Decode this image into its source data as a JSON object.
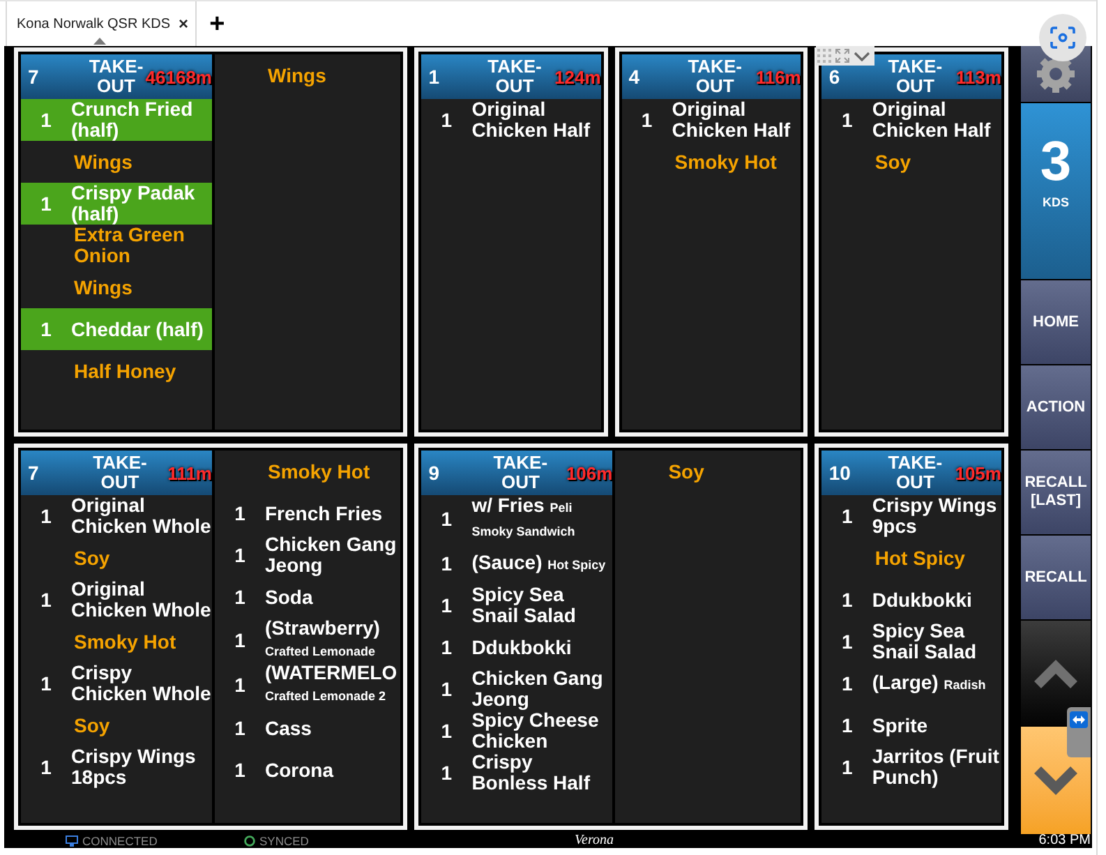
{
  "browser": {
    "tabs": [
      {
        "title": "Kona Norwalk QSR KDS",
        "close": "×"
      }
    ],
    "new_tab": "+"
  },
  "tickets": [
    {
      "number": "7",
      "order_type": "TAKE-OUT",
      "elapsed": "46168m",
      "columns": [
        {
          "lines": [
            {
              "kind": "item",
              "qty": "1",
              "name": "Crunch Fried (half)",
              "highlighted": true
            },
            {
              "kind": "modifier",
              "text": "Wings"
            },
            {
              "kind": "item",
              "qty": "1",
              "name": "Crispy Padak (half)",
              "highlighted": true
            },
            {
              "kind": "modifier",
              "text": "Extra Green Onion"
            },
            {
              "kind": "modifier",
              "text": "Wings"
            },
            {
              "kind": "item",
              "qty": "1",
              "name": "Cheddar (half)",
              "highlighted": true
            },
            {
              "kind": "modifier",
              "text": "Half Honey"
            }
          ]
        },
        {
          "lines": [
            {
              "kind": "modifier",
              "text": "Wings"
            }
          ]
        }
      ]
    },
    {
      "number": "1",
      "order_type": "TAKE-OUT",
      "elapsed": "124m",
      "columns": [
        {
          "lines": [
            {
              "kind": "item",
              "qty": "1",
              "name": "Original Chicken Half",
              "highlighted": false
            }
          ]
        }
      ]
    },
    {
      "number": "4",
      "order_type": "TAKE-OUT",
      "elapsed": "116m",
      "columns": [
        {
          "lines": [
            {
              "kind": "item",
              "qty": "1",
              "name": "Original Chicken Half",
              "highlighted": false
            },
            {
              "kind": "modifier",
              "text": "Smoky Hot"
            }
          ]
        }
      ]
    },
    {
      "number": "6",
      "order_type": "TAKE-OUT",
      "elapsed": "113m",
      "columns": [
        {
          "lines": [
            {
              "kind": "item",
              "qty": "1",
              "name": "Original Chicken Half",
              "highlighted": false
            },
            {
              "kind": "modifier",
              "text": "Soy"
            }
          ]
        }
      ]
    },
    {
      "number": "7",
      "order_type": "TAKE-OUT",
      "elapsed": "111m",
      "columns": [
        {
          "lines": [
            {
              "kind": "item",
              "qty": "1",
              "name": "Original Chicken Whole",
              "highlighted": false
            },
            {
              "kind": "modifier",
              "text": "Soy"
            },
            {
              "kind": "item",
              "qty": "1",
              "name": "Original Chicken Whole",
              "highlighted": false
            },
            {
              "kind": "modifier",
              "text": "Smoky Hot"
            },
            {
              "kind": "item",
              "qty": "1",
              "name": "Crispy Chicken Whole",
              "highlighted": false
            },
            {
              "kind": "modifier",
              "text": "Soy"
            },
            {
              "kind": "item",
              "qty": "1",
              "name": "Crispy Wings 18pcs",
              "highlighted": false
            }
          ]
        },
        {
          "lines": [
            {
              "kind": "modifier",
              "text": "Smoky Hot"
            },
            {
              "kind": "item",
              "qty": "1",
              "name": "French Fries",
              "highlighted": false
            },
            {
              "kind": "item",
              "qty": "1",
              "name": "Chicken Gang Jeong",
              "highlighted": false
            },
            {
              "kind": "item",
              "qty": "1",
              "name": "Soda",
              "highlighted": false
            },
            {
              "kind": "item",
              "qty": "1",
              "name": "(Strawberry)",
              "note": "Crafted Lemonade",
              "highlighted": false
            },
            {
              "kind": "item",
              "qty": "1",
              "name": "(WATERMELO",
              "note": "Crafted Lemonade 2",
              "highlighted": false
            },
            {
              "kind": "item",
              "qty": "1",
              "name": "Cass",
              "highlighted": false
            },
            {
              "kind": "item",
              "qty": "1",
              "name": "Corona",
              "highlighted": false
            }
          ]
        }
      ]
    },
    {
      "number": "9",
      "order_type": "TAKE-OUT",
      "elapsed": "106m",
      "columns": [
        {
          "lines": [
            {
              "kind": "item",
              "qty": "1",
              "name": "w/ Fries",
              "note": "Peli Smoky Sandwich",
              "highlighted": false
            },
            {
              "kind": "item",
              "qty": "1",
              "name": "(Sauce)",
              "note": "Hot Spicy",
              "highlighted": false
            },
            {
              "kind": "item",
              "qty": "1",
              "name": "Spicy Sea Snail Salad",
              "highlighted": false
            },
            {
              "kind": "item",
              "qty": "1",
              "name": "Ddukbokki",
              "highlighted": false
            },
            {
              "kind": "item",
              "qty": "1",
              "name": "Chicken Gang Jeong",
              "highlighted": false
            },
            {
              "kind": "item",
              "qty": "1",
              "name": "Spicy Cheese Chicken",
              "highlighted": false
            },
            {
              "kind": "item",
              "qty": "1",
              "name": "Crispy Bonless Half",
              "highlighted": false
            }
          ]
        },
        {
          "lines": [
            {
              "kind": "modifier",
              "text": "Soy"
            }
          ]
        }
      ]
    },
    {
      "number": "10",
      "order_type": "TAKE-OUT",
      "elapsed": "105m",
      "columns": [
        {
          "lines": [
            {
              "kind": "item",
              "qty": "1",
              "name": "Crispy Wings 9pcs",
              "highlighted": false
            },
            {
              "kind": "modifier",
              "text": "Hot Spicy"
            },
            {
              "kind": "item",
              "qty": "1",
              "name": "Ddukbokki",
              "highlighted": false
            },
            {
              "kind": "item",
              "qty": "1",
              "name": "Spicy Sea Snail Salad",
              "highlighted": false
            },
            {
              "kind": "item",
              "qty": "1",
              "name": "(Large)",
              "note": "Radish",
              "highlighted": false
            },
            {
              "kind": "item",
              "qty": "1",
              "name": "Sprite",
              "highlighted": false
            },
            {
              "kind": "item",
              "qty": "1",
              "name": "Jarritos (Fruit Punch)",
              "highlighted": false
            }
          ]
        }
      ]
    }
  ],
  "sidebar": [
    {
      "kind": "settings"
    },
    {
      "kind": "counter",
      "value": "3",
      "label": "KDS"
    },
    {
      "kind": "button",
      "label": "HOME"
    },
    {
      "kind": "button",
      "label": "ACTION"
    },
    {
      "kind": "button",
      "label": "RECALL [LAST]"
    },
    {
      "kind": "button",
      "label": "RECALL"
    },
    {
      "kind": "scroll_up",
      "on": false
    },
    {
      "kind": "scroll_down",
      "on": true
    }
  ],
  "status_bar": {
    "connection": "CONNECTED",
    "sync": "SYNCED",
    "location": "Verona",
    "time": "6:03 PM"
  }
}
